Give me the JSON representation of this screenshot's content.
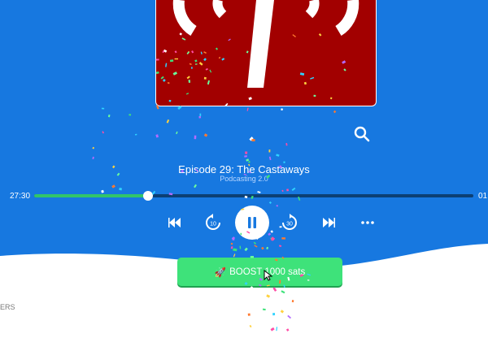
{
  "player": {
    "episode_title": "Episode 29: The Castaways",
    "podcast_name": "Podcasting 2.0",
    "elapsed": "27:30",
    "remaining": "01",
    "progress": 0.26
  },
  "controls": {
    "skip_back_seconds": "10",
    "skip_forward_seconds": "30"
  },
  "boost": {
    "label": "BOOST 1000 sats"
  },
  "side_label": "ERS",
  "colors": {
    "background": "#1778e0",
    "artwork": "#a20000",
    "progress_fill": "#31c46a",
    "progress_track": "#0c3f74",
    "boost_button": "#3ee27a"
  },
  "icons": [
    "search-icon",
    "skip-previous-icon",
    "replay-10-icon",
    "pause-icon",
    "forward-30-icon",
    "skip-next-icon",
    "more-icon",
    "rocket-icon",
    "cursor-icon"
  ]
}
